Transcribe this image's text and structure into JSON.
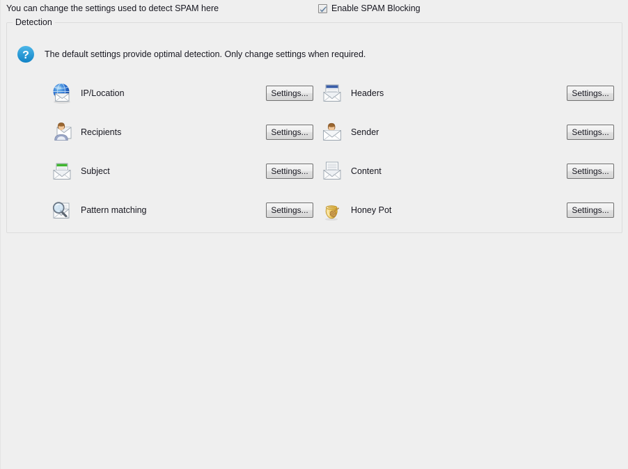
{
  "window": {
    "background_color": "#efefef",
    "hint": "You can change the settings used to detect SPAM here"
  },
  "enable_spam_blocking": {
    "label": "Enable SPAM Blocking",
    "checked": true,
    "check_color": "#5f7f9f"
  },
  "group": {
    "legend": "Detection",
    "help_text": "The default settings provide optimal detection. Only change settings when required.",
    "help_icon": "help-question-icon",
    "help_icon_color": "#2196d8"
  },
  "rows": [
    {
      "left": {
        "icon": "ip-location-globe-envelope-icon",
        "label": "IP/Location",
        "button": "Settings..."
      },
      "right": {
        "icon": "headers-envelope-document-icon",
        "label": "Headers",
        "button": "Settings..."
      }
    },
    {
      "left": {
        "icon": "recipients-person-envelope-icon",
        "label": "Recipients",
        "button": "Settings..."
      },
      "right": {
        "icon": "sender-person-envelope-icon",
        "label": "Sender",
        "button": "Settings..."
      }
    },
    {
      "left": {
        "icon": "subject-green-document-envelope-icon",
        "label": "Subject",
        "button": "Settings..."
      },
      "right": {
        "icon": "content-lined-document-envelope-icon",
        "label": "Content",
        "button": "Settings..."
      }
    },
    {
      "left": {
        "icon": "pattern-matching-magnifier-icon",
        "label": "Pattern matching",
        "button": "Settings..."
      },
      "right": {
        "icon": "honey-pot-icon",
        "label": "Honey Pot",
        "button": "Settings..."
      }
    }
  ]
}
